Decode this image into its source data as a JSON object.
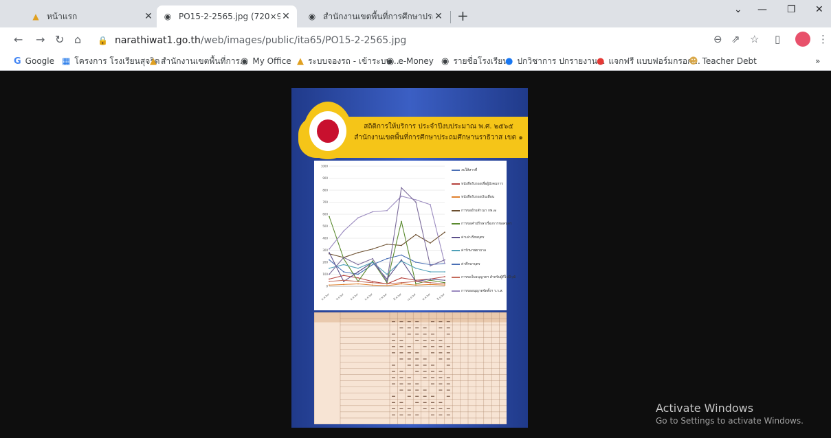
{
  "browser": {
    "tabs": [
      {
        "title": "หน้าแรก",
        "active": false
      },
      {
        "title": "PO15-2-2565.jpg (720×960)",
        "active": true
      },
      {
        "title": "สำนักงานเขตพื้นที่การศึกษาประถมศึก",
        "active": false
      }
    ],
    "url_host": "narathiwat1.go.th",
    "url_path": "/web/images/public/ita65/PO15-2-2565.jpg",
    "bookmarks": [
      {
        "label": "Google",
        "icon": "google-icon"
      },
      {
        "label": "โครงการ โรงเรียนสุจริต",
        "icon": "grid-icon"
      },
      {
        "label": "สำนักงานเขตพื้นที่การ...",
        "icon": "obec-icon"
      },
      {
        "label": "My Office",
        "icon": "globe-icon"
      },
      {
        "label": "ระบบจองรถ - เข้าระบบ...",
        "icon": "obec-icon"
      },
      {
        "label": "e-Money",
        "icon": "globe-icon"
      },
      {
        "label": "รายชื่อโรงเรียน",
        "icon": "globe-icon"
      },
      {
        "label": "ปกวิชาการ ปกรายงาน...",
        "icon": "facebook-icon"
      },
      {
        "label": "แจกฟรี แบบฟอร์มกรอก...",
        "icon": "red-icon"
      },
      {
        "label": "Teacher Debt",
        "icon": "person-icon"
      }
    ],
    "more_bookmarks": "»"
  },
  "poster": {
    "title_line1": "สถิติการให้บริการ ประจำปีงบประมาณ พ.ศ. ๒๕๖๕",
    "title_line2": "สำนักงานเขตพื้นที่การศึกษาประถมศึกษานราธิวาส เขต ๑",
    "legend": [
      {
        "label": "งบให้สารที่",
        "color": "#4a6fb5"
      },
      {
        "label": "หนังสือรับรองเพื่อผู้บังคมการ",
        "color": "#b5413c"
      },
      {
        "label": "หนังสือรับรองเงินเดือน",
        "color": "#e0802c"
      },
      {
        "label": "การขอย้ายสำเนา กพ.๗",
        "color": "#6b4e2e"
      },
      {
        "label": "การขอคำปรึกษาเรื่องการขอคนคร",
        "color": "#5a8a2e"
      },
      {
        "label": "ค่าเล่าเรียนบุตร",
        "color": "#5b4f8a"
      },
      {
        "label": "ค่ารักษาพยาบาล",
        "color": "#4fa0b8"
      },
      {
        "label": "ค่าศึกษาบุตร",
        "color": "#4a6fb5"
      },
      {
        "label": "การขอใบอนุญาตฯ สำหรับผู้ที่ไม่มีวุฒิ",
        "color": "#c46a5a"
      },
      {
        "label": "การขออนุญาตจัดตั้งฯ ร.ร.ส.",
        "color": "#9a8abf"
      }
    ]
  },
  "chart_data": {
    "type": "line",
    "categories": [
      "ต.ค.๖๔",
      "พ.ย.๖๔",
      "ธ.ค.๖๔",
      "ม.ค.๖๕",
      "ก.พ.๖๕",
      "มี.ค.๖๕",
      "เม.ย.๖๕",
      "พ.ค.๖๕",
      "มิ.ย.๖๕"
    ],
    "ylim": [
      0,
      1000
    ],
    "series": [
      {
        "color": "#4a6fb5",
        "values": [
          220,
          120,
          100,
          180,
          230,
          260,
          200,
          180,
          190
        ]
      },
      {
        "color": "#b5413c",
        "values": [
          60,
          90,
          70,
          40,
          20,
          70,
          50,
          60,
          80
        ]
      },
      {
        "color": "#e0802c",
        "values": [
          10,
          15,
          20,
          10,
          5,
          20,
          10,
          15,
          10
        ]
      },
      {
        "color": "#6b4e2e",
        "values": [
          270,
          240,
          280,
          310,
          350,
          340,
          430,
          360,
          450
        ]
      },
      {
        "color": "#5a8a2e",
        "values": [
          580,
          230,
          40,
          210,
          30,
          540,
          20,
          50,
          30
        ]
      },
      {
        "color": "#5b4f8a",
        "values": [
          280,
          40,
          120,
          200,
          60,
          220,
          40,
          60,
          50
        ]
      },
      {
        "color": "#4fa0b8",
        "values": [
          150,
          180,
          150,
          200,
          100,
          210,
          150,
          120,
          120
        ]
      },
      {
        "color": "#c46a5a",
        "values": [
          40,
          50,
          40,
          30,
          20,
          30,
          40,
          30,
          20
        ]
      },
      {
        "color": "#9a8abf",
        "values": [
          310,
          460,
          570,
          620,
          630,
          750,
          720,
          680,
          190
        ]
      },
      {
        "color": "#7a6a9a",
        "values": [
          100,
          240,
          180,
          230,
          40,
          820,
          700,
          170,
          220
        ]
      }
    ]
  },
  "os": {
    "activate_title": "Activate Windows",
    "activate_sub": "Go to Settings to activate Windows."
  }
}
